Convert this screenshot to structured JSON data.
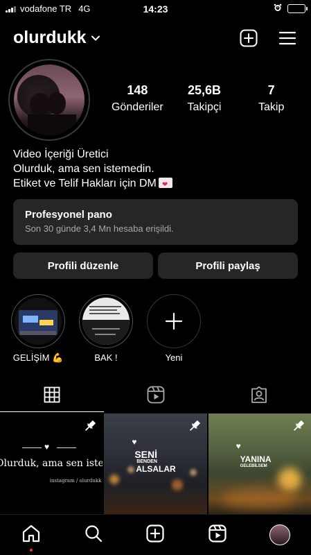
{
  "status_bar": {
    "carrier": "vodafone TR",
    "network": "4G",
    "time": "14:23"
  },
  "header": {
    "username": "olurdukk",
    "icons": [
      "chevron-down-icon",
      "add-post-icon",
      "menu-icon"
    ]
  },
  "profile": {
    "stats": [
      {
        "value": "148",
        "label": "Gönderiler"
      },
      {
        "value": "25,6B",
        "label": "Takipçi"
      },
      {
        "value": "7",
        "label": "Takip"
      }
    ],
    "bio": {
      "category": "Video İçeriği Üretici",
      "line1": "Olurduk, ama sen istemedin.",
      "line2": "Etiket ve Telif Hakları için DM"
    }
  },
  "pano": {
    "title": "Profesyonel pano",
    "subtitle": "Son 30 günde 3,4 Mn hesaba erişildi."
  },
  "buttons": {
    "edit": "Profili düzenle",
    "share": "Profili paylaş"
  },
  "highlights": [
    {
      "label": "GELİŞİM 💪"
    },
    {
      "label": "BAK !"
    },
    {
      "label": "Yeni"
    }
  ],
  "tabs": [
    "grid-icon",
    "reels-icon",
    "tagged-icon"
  ],
  "posts": [
    {
      "caption": "Olurduk, ama sen istemedin.",
      "source": "instagram / olurdukk",
      "pinned": true
    },
    {
      "line1": "SENİ",
      "line2": "BENDEN",
      "line3": "ALSALAR",
      "pinned": true
    },
    {
      "line1": "YANINA",
      "line2": "GELEBİLSEM",
      "pinned": true
    }
  ],
  "nav": [
    "home-icon",
    "search-icon",
    "create-icon",
    "reels-icon",
    "profile-avatar"
  ],
  "colors": {
    "background": "#000000",
    "surface": "#262626",
    "notification": "#ff3040"
  }
}
